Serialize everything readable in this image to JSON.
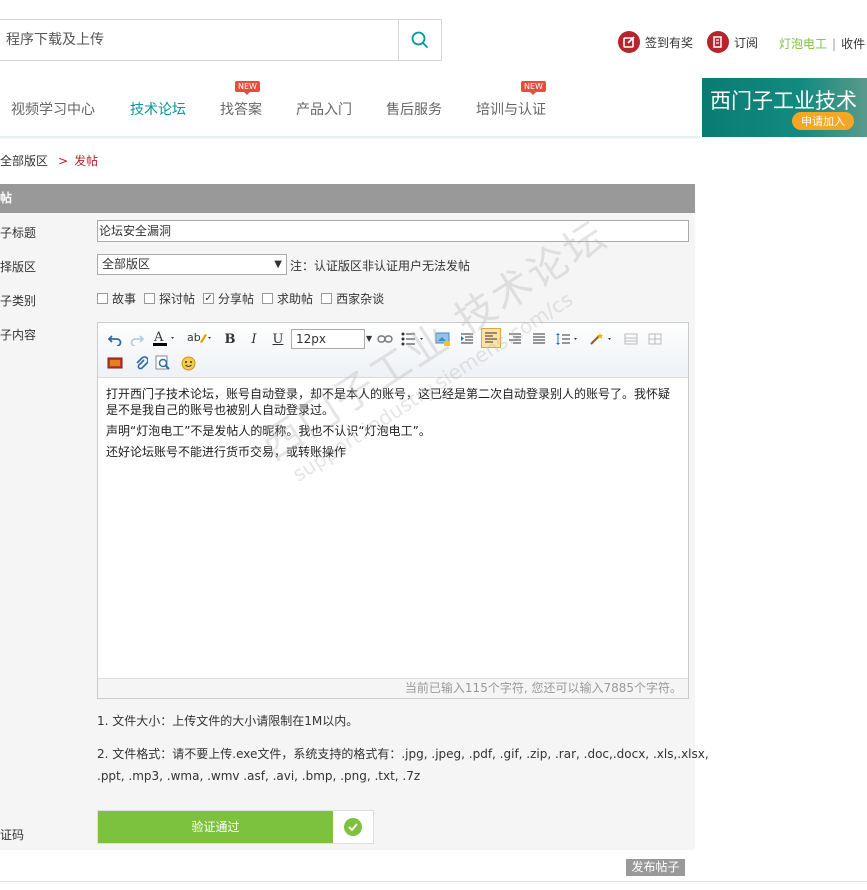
{
  "header": {
    "search_placeholder": "程序下载及上传",
    "checkin_label": "签到有奖",
    "subscribe_label": "订阅",
    "username": "灯泡电工",
    "separator": "|",
    "favorites_label": "收件"
  },
  "nav": {
    "items": [
      {
        "label": "视频学习中心"
      },
      {
        "label": "技术论坛",
        "active": true
      },
      {
        "label": "找答案",
        "badge": "NEW"
      },
      {
        "label": "产品入门"
      },
      {
        "label": "售后服务"
      },
      {
        "label": "培训与认证",
        "badge": "NEW"
      }
    ]
  },
  "banner": {
    "title": "西门子工业技术",
    "button": "申请加入"
  },
  "breadcrumb": {
    "home": "全部版区",
    "separator": ">",
    "current": "发帖"
  },
  "form": {
    "header": "帖",
    "labels": {
      "title": "子标题",
      "board": "择版区",
      "category": "子类别",
      "content": "子内容",
      "captcha": "证码"
    },
    "title_value": "论坛安全漏洞",
    "board_value": "全部版区",
    "board_note": "注：认证版区非认证用户无法发帖",
    "categories": [
      {
        "label": "故事",
        "checked": false
      },
      {
        "label": "探讨帖",
        "checked": false
      },
      {
        "label": "分享帖",
        "checked": true
      },
      {
        "label": "求助帖",
        "checked": false
      },
      {
        "label": "西家杂谈",
        "checked": false
      }
    ],
    "checkmark": "✓"
  },
  "editor": {
    "font_size": "12px",
    "content_lines": [
      "打开西门子技术论坛，账号自动登录，却不是本人的账号，这已经是第二次自动登录别人的账号了。我怀疑是不是我自己的账号也被别人自动登录过。",
      "声明“灯泡电工”不是发帖人的昵称。我也不认识“灯泡电工”。",
      "还好论坛账号不能进行货币交易，或转账操作"
    ],
    "counter": "当前已输入115个字符, 您还可以输入7885个字符。",
    "watermark_line1": "西门子工业 技术论坛",
    "watermark_line2": "support.industry.siemens.com/cs"
  },
  "notes": {
    "size_limit": "1. 文件大小：上传文件的大小请限制在1M以内。",
    "formats_line1": "2. 文件格式：请不要上传.exe文件，系统支持的格式有：.jpg, .jpeg, .pdf, .gif, .zip, .rar, .doc,.docx, .xls,.xlsx,",
    "formats_line2": ".ppt, .mp3, .wma, .wmv .asf, .avi, .bmp, .png, .txt, .7z"
  },
  "captcha": {
    "status": "验证通过"
  },
  "submit_label": "发布帖子",
  "colors": {
    "accent": "#009999",
    "brand_red": "#b3262b",
    "verify_green": "#7cc23e"
  }
}
